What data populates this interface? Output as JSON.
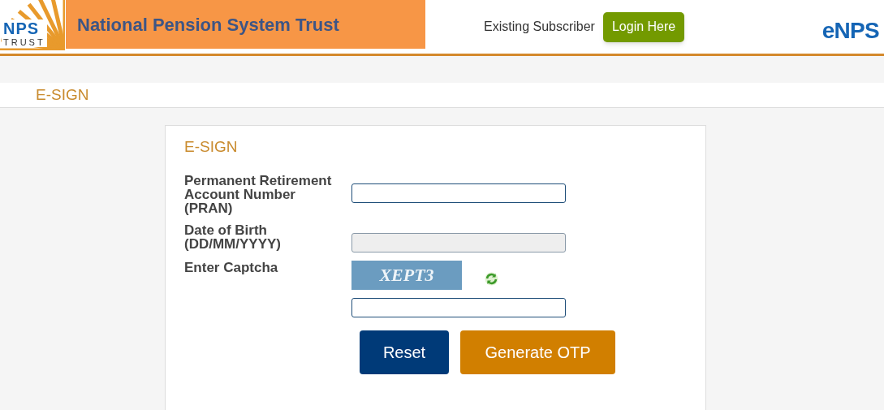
{
  "header": {
    "logo": {
      "mark": "NPS",
      "sub": "TRUST"
    },
    "banner_title": "National Pension System Trust",
    "subscriber_label": "Existing Subscriber",
    "login_button": "Login Here",
    "brand": "eNPS"
  },
  "page_title": "E-SIGN",
  "form": {
    "title": "E-SIGN",
    "fields": [
      {
        "kind": "text",
        "label": "Permanent Retirement Account Number (PRAN)",
        "disabled": false
      },
      {
        "kind": "text",
        "label": "Date of Birth (DD/MM/YYYY)",
        "disabled": true
      },
      {
        "kind": "captcha",
        "label": "Enter Captcha",
        "captcha_text": "XEPT3",
        "disabled": false
      }
    ],
    "buttons": [
      {
        "label": "Reset",
        "kind": "secondary"
      },
      {
        "label": "Generate OTP",
        "kind": "primary"
      }
    ]
  }
}
